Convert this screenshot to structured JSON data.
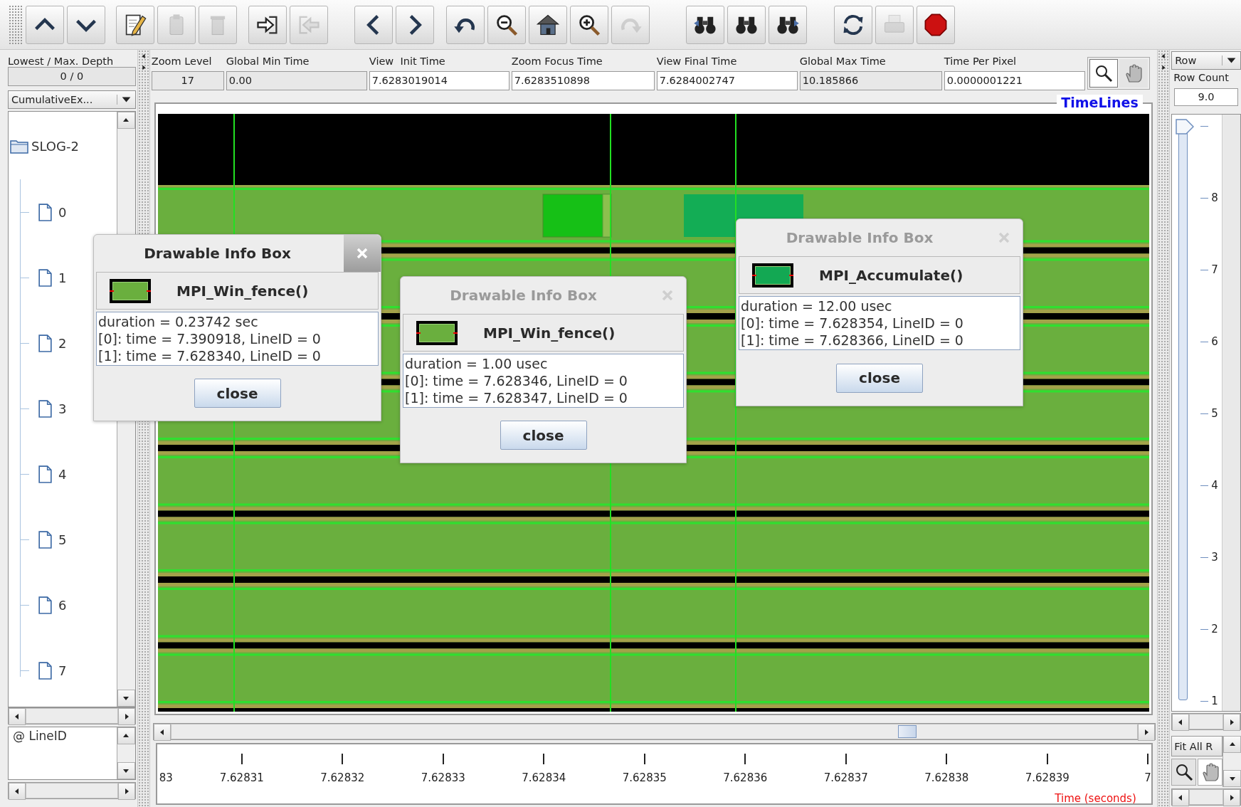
{
  "toolbar": [
    [
      {
        "disabled": false
      },
      {
        "disabled": false
      }
    ],
    [
      {
        "disabled": false
      },
      {
        "disabled": true
      },
      {
        "disabled": true
      }
    ],
    [
      {
        "disabled": false
      },
      {
        "disabled": true
      }
    ],
    [
      {
        "disabled": false
      },
      {
        "disabled": false
      }
    ],
    [
      {
        "disabled": false
      },
      {
        "disabled": false
      },
      {
        "disabled": false
      },
      {
        "disabled": false
      },
      {
        "disabled": true
      }
    ],
    [
      {
        "disabled": false
      },
      {
        "disabled": false
      },
      {
        "disabled": false
      }
    ],
    [
      {
        "disabled": false
      },
      {
        "disabled": true
      },
      {
        "disabled": false
      }
    ]
  ],
  "depth": {
    "label": "Lowest / Max. Depth",
    "value": "0 / 0"
  },
  "legend_dropdown": {
    "value": "CumulativeEx..."
  },
  "tree": {
    "label": "SLOG-2",
    "children": [
      {
        "label": "0"
      },
      {
        "label": "1"
      },
      {
        "label": "2"
      },
      {
        "label": "3"
      },
      {
        "label": "4"
      },
      {
        "label": "5"
      },
      {
        "label": "6"
      },
      {
        "label": "7"
      }
    ]
  },
  "lineid_list": [
    "@ LineID"
  ],
  "time_fields": [
    {
      "label": "Zoom Level",
      "value": "17",
      "editable": false
    },
    {
      "label": "Global Min Time",
      "value": "0.00",
      "editable": false
    },
    {
      "label": "View  Init Time",
      "value": "7.6283019014",
      "editable": true
    },
    {
      "label": "Zoom Focus Time",
      "value": "7.6283510898",
      "editable": true
    },
    {
      "label": "View Final Time",
      "value": "7.6284002747",
      "editable": true
    },
    {
      "label": "Global Max Time",
      "value": "10.185866",
      "editable": false
    },
    {
      "label": "Time Per Pixel",
      "value": "0.0000001221",
      "editable": true
    }
  ],
  "view_tools": [
    {
      "selected": true
    },
    {
      "selected": false
    }
  ],
  "timelines": {
    "title": "TimeLines"
  },
  "time_axis": {
    "left_partial": "83",
    "ticks": [
      "7.62831",
      "7.62832",
      "7.62833",
      "7.62834",
      "7.62835",
      "7.62836",
      "7.62837",
      "7.62838",
      "7.62839"
    ],
    "right_partial": "7",
    "title": "Time (seconds)"
  },
  "row_panel": {
    "dropdown": "Row",
    "count_label": "Row Count",
    "count_value": "9.0",
    "slider": {
      "level": 1
    },
    "ruler": [
      "8",
      "7",
      "6",
      "5",
      "4",
      "3",
      "2",
      "1"
    ],
    "fit_button": "Fit All R",
    "tools": [
      {
        "selected": false
      },
      {
        "selected": true
      }
    ]
  },
  "info_boxes": [
    {
      "title": "Drawable Info Box",
      "active": true,
      "name": "MPI_Win_fence()",
      "color": "#6aaf3e",
      "lines": [
        "duration = 0.23742 sec",
        "[0]: time = 7.390918, LineID = 0",
        "[1]: time = 7.628340, LineID = 0"
      ],
      "button": "close"
    },
    {
      "title": "Drawable Info Box",
      "active": false,
      "name": "MPI_Win_fence()",
      "color": "#6aaf3e",
      "lines": [
        "duration = 1.00 usec",
        "[0]: time = 7.628346, LineID = 0",
        "[1]: time = 7.628347, LineID = 0"
      ],
      "button": "close"
    },
    {
      "title": "Drawable Info Box",
      "active": false,
      "name": "MPI_Accumulate()",
      "color": "#13a853",
      "lines": [
        "duration = 12.00 usec",
        "[0]: time = 7.628354, LineID = 0",
        "[1]: time = 7.628366, LineID = 0"
      ],
      "button": "close"
    }
  ]
}
